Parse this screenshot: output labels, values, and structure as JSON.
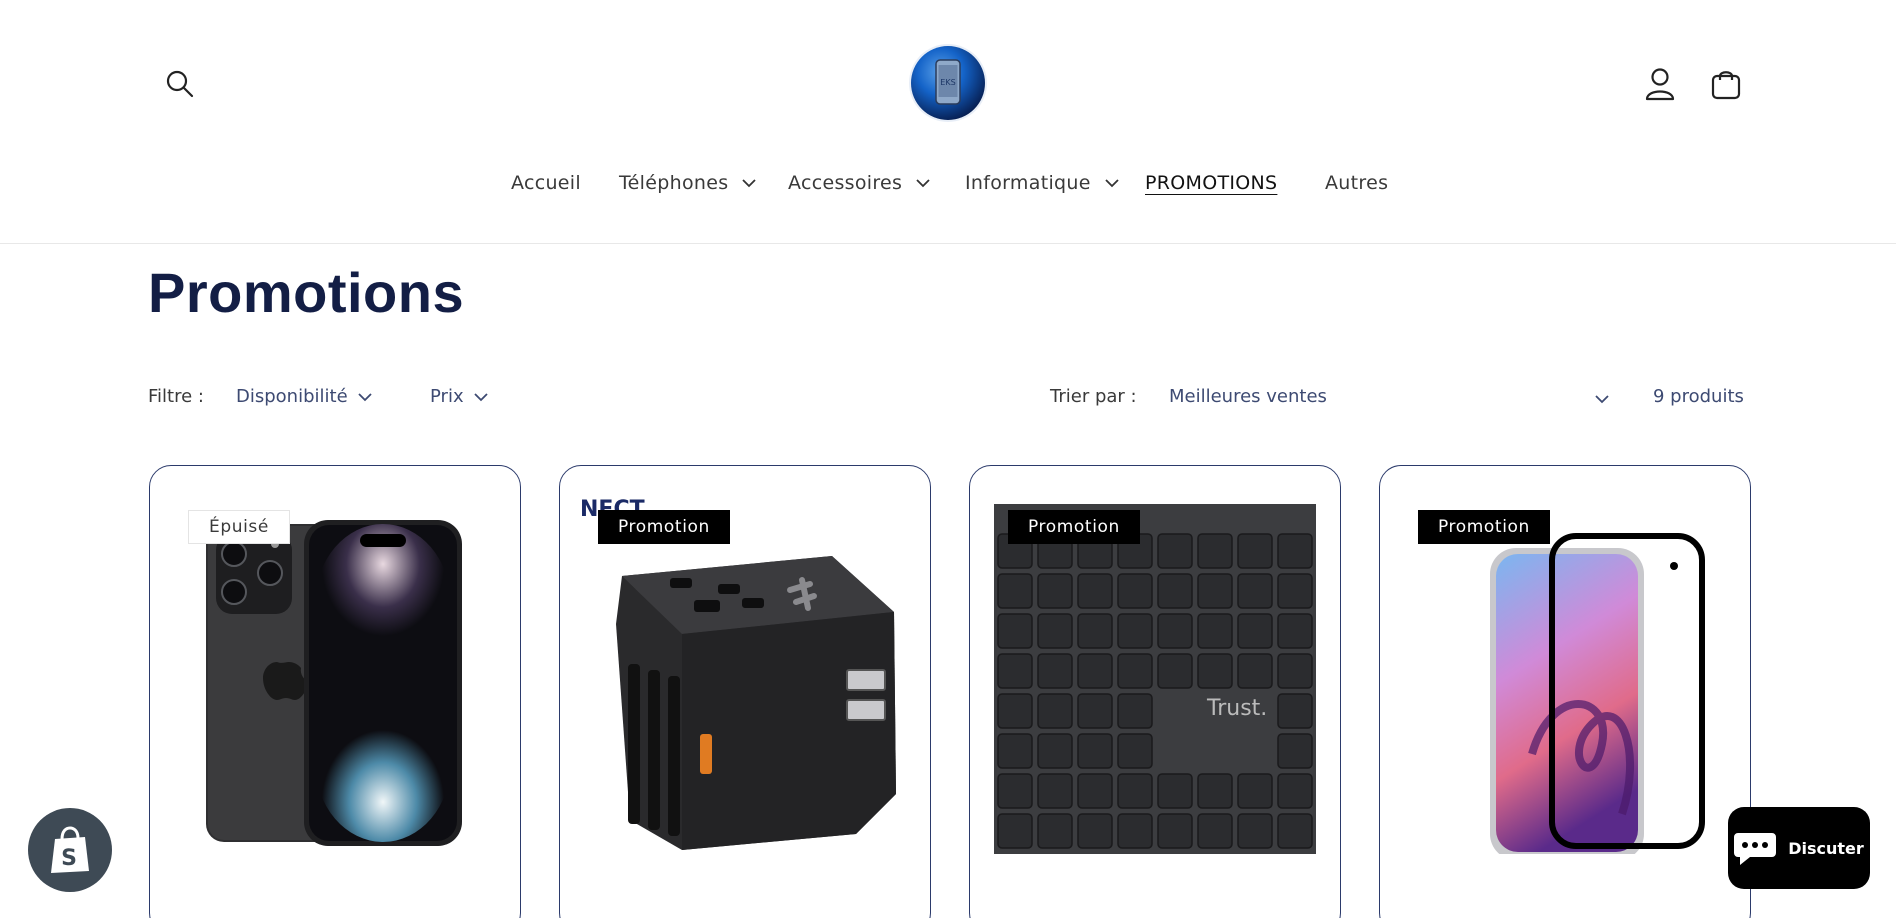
{
  "header": {
    "logo_text": "EKS",
    "icons": {
      "search": "search-icon",
      "account": "user-icon",
      "cart": "shopping-bag-icon"
    }
  },
  "nav": {
    "items": [
      {
        "label": "Accueil",
        "dropdown": false
      },
      {
        "label": "Téléphones",
        "dropdown": true
      },
      {
        "label": "Accessoires",
        "dropdown": true
      },
      {
        "label": "Informatique",
        "dropdown": true
      },
      {
        "label": "PROMOTIONS",
        "dropdown": false,
        "active": true
      },
      {
        "label": "Autres",
        "dropdown": false
      }
    ]
  },
  "page": {
    "title": "Promotions"
  },
  "filters": {
    "filter_label": "Filtre :",
    "availability": "Disponibilité",
    "price": "Prix",
    "sort_label": "Trier par :",
    "sort_value": "Meilleures ventes",
    "count": "9 produits"
  },
  "products": [
    {
      "badge": "Épuisé",
      "badge_style": "sold",
      "image": "iphone-14-pro"
    },
    {
      "badge": "Promotion",
      "badge_style": "promo",
      "image": "travel-adapter",
      "brand_fragment": "NECT"
    },
    {
      "badge": "Promotion",
      "badge_style": "promo",
      "image": "keyboard",
      "brand": "Trust."
    },
    {
      "badge": "Promotion",
      "badge_style": "promo",
      "image": "screen-protector-phone"
    }
  ],
  "chat": {
    "label": "Discuter"
  },
  "colors": {
    "title": "#131e45",
    "card_border": "#2b3a6b",
    "badge_promo_bg": "#000000",
    "shopify_bubble": "#3e4a55"
  }
}
